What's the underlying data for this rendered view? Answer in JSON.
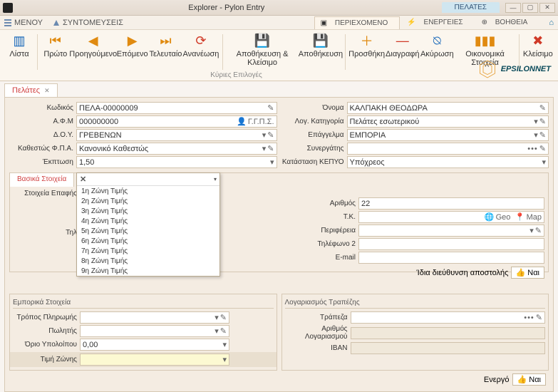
{
  "window": {
    "title": "Explorer - Pylon Entry",
    "context_tab": "ΠΕΛΑΤΕΣ"
  },
  "menubar": {
    "menu": "ΜΕΝΟΥ",
    "shortcuts": "ΣΥΝΤΟΜΕΥΣΕΙΣ",
    "tab_content": "ΠΕΡΙΕΧΟΜΕΝΟ",
    "tab_actions": "ΕΝΕΡΓΕΙΕΣ",
    "tab_help": "ΒΟΗΘΕΙΑ"
  },
  "ribbon": {
    "list": "Λίστα",
    "first": "Πρώτο",
    "prev": "Προηγούμενο",
    "next": "Επόμενο",
    "last": "Τελευταίο",
    "refresh": "Ανανέωση",
    "save_close": "Αποθήκευση & Κλείσιμο",
    "save": "Αποθήκευση",
    "add": "Προσθήκη",
    "delete": "Διαγραφή",
    "cancel": "Ακύρωση",
    "fin": "Οικονομικά Στοιχεία",
    "close": "Κλείσιμο",
    "caption": "Κύριες Επιλογές"
  },
  "brand": "EPSILONNET",
  "tab": {
    "label": "Πελάτες"
  },
  "labels": {
    "code": "Κωδικός",
    "afm": "Α.Φ.Μ",
    "doy": "Δ.Ο.Υ.",
    "vat": "Καθεστώς Φ.Π.Α.",
    "discount": "Έκπτωση",
    "name": "Όνομα",
    "cat": "Λογ. Κατηγορία",
    "job": "Επάγγελμα",
    "partner": "Συνεργάτης",
    "kepyo": "Κατάσταση ΚΕΠΥΟ",
    "basic": "Βασικά Στοιχεία",
    "contact": "Στοιχεία Επαφής",
    "phone": "Τηλ",
    "number": "Αριθμός",
    "tk": "Τ.Κ.",
    "region": "Περιφέρεια",
    "phone2": "Τηλέφωνο 2",
    "email": "E-mail",
    "same_addr": "Ίδια διεύθυνση αποστολής",
    "yes": "Ναι",
    "commercial": "Εμπορικά  Στοιχεία",
    "paytype": "Τρόπος Πληρωμής",
    "seller": "Πωλητής",
    "limit": "Όριο Υπολοίπου",
    "zone": "Τιμή Ζώνης",
    "bank_section": "Λογαριασμός Τραπέζης",
    "bank": "Τράπεζα",
    "acct": "Αριθμός Λογαριασμού",
    "iban": "IBAN",
    "active": "Ενεργό",
    "geo": "Geo",
    "map": "Map",
    "ggps": "Γ.Γ.Π.Σ."
  },
  "values": {
    "code": "ΠΕΛΑ-00000009",
    "afm": "000000000",
    "doy": "ΓΡΕΒΕΝΩΝ",
    "vat": "Κανονικό Καθεστώς",
    "discount": "1,50",
    "name": "ΚΑΛΠΑΚΗ ΘΕΟΔΩΡΑ",
    "cat": "Πελάτες εσωτερικού",
    "job": "ΕΜΠΟΡΙΑ",
    "kepyo": "Υπόχρεος",
    "number": "22",
    "limit": "0,00"
  },
  "zone_options": [
    "1η Ζώνη Τιμής",
    "2η Ζώνη Τιμής",
    "3η Ζώνη Τιμής",
    "4η Ζώνη Τιμής",
    "5η Ζώνη Τιμής",
    "6η Ζώνη Τιμής",
    "7η Ζώνη Τιμής",
    "8η Ζώνη Τιμής",
    "9η Ζώνη Τιμής"
  ]
}
